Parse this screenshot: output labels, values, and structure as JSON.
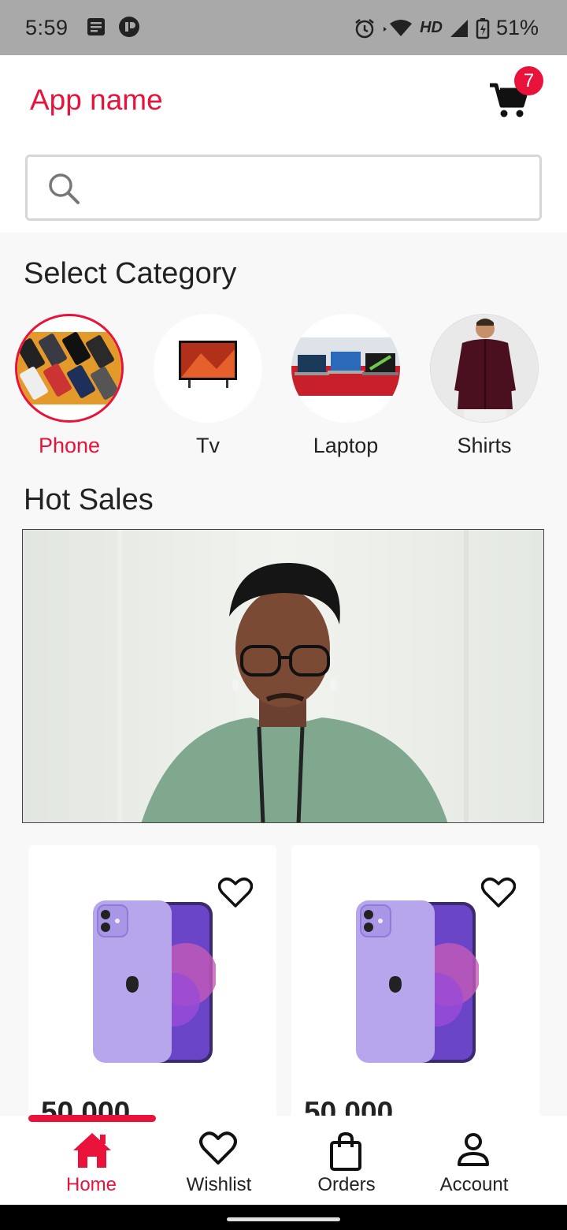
{
  "status_bar": {
    "time": "5:59",
    "battery": "51%",
    "network": "HD"
  },
  "app_bar": {
    "title": "App name",
    "cart_count": "7"
  },
  "search": {
    "placeholder": ""
  },
  "categories_section": {
    "title": "Select Category",
    "items": [
      {
        "label": "Phone",
        "active": true
      },
      {
        "label": "Tv",
        "active": false
      },
      {
        "label": "Laptop",
        "active": false
      },
      {
        "label": "Shirts",
        "active": false
      }
    ]
  },
  "hot_sales": {
    "title": "Hot Sales"
  },
  "products": [
    {
      "price": "50,000"
    },
    {
      "price": "50,000"
    }
  ],
  "bottom_nav": {
    "items": [
      {
        "label": "Home",
        "icon": "home-icon",
        "active": true
      },
      {
        "label": "Wishlist",
        "icon": "heart-icon",
        "active": false
      },
      {
        "label": "Orders",
        "icon": "shopping-bag-icon",
        "active": false
      },
      {
        "label": "Account",
        "icon": "person-icon",
        "active": false
      }
    ]
  },
  "colors": {
    "accent": "#e8123a",
    "status_bar": "#a9a9a9",
    "background": "#f8f8f8"
  }
}
